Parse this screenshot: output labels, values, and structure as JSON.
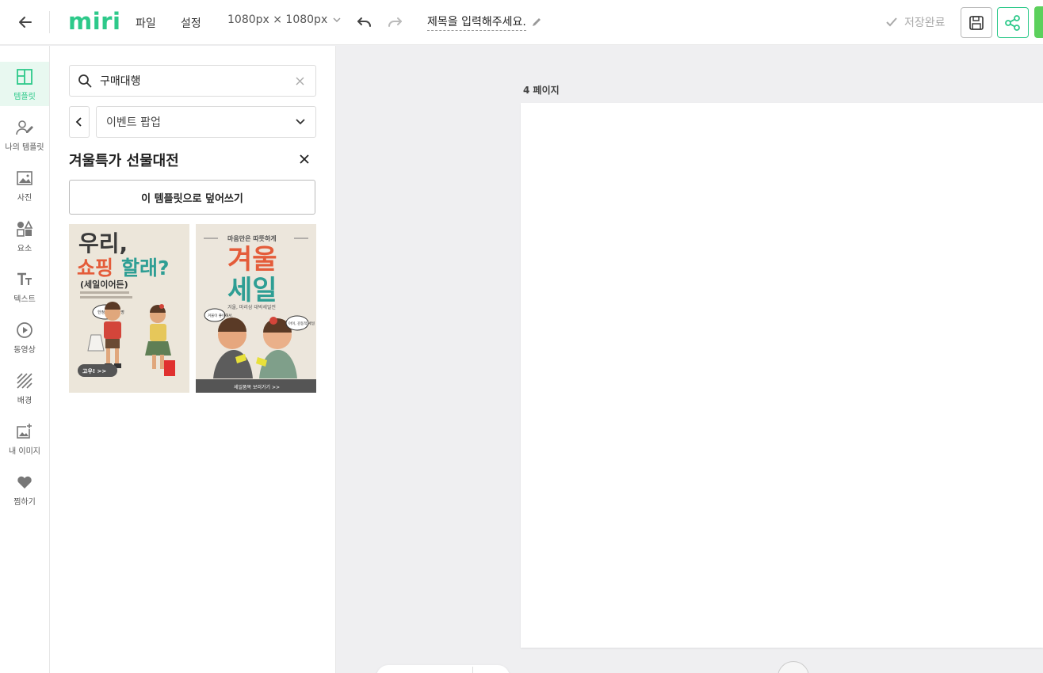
{
  "topbar": {
    "logo": "miri",
    "menu_file": "파일",
    "menu_settings": "설정",
    "size": "1080px × 1080px",
    "doc_title": "제목을 입력해주세요.",
    "save_status": "저장완료"
  },
  "rail": {
    "items": [
      {
        "label": "템플릿",
        "icon": "template-icon"
      },
      {
        "label": "나의 템플릿",
        "icon": "my-template-icon"
      },
      {
        "label": "사진",
        "icon": "photo-icon"
      },
      {
        "label": "요소",
        "icon": "elements-icon"
      },
      {
        "label": "텍스트",
        "icon": "text-icon"
      },
      {
        "label": "동영상",
        "icon": "video-icon"
      },
      {
        "label": "배경",
        "icon": "background-icon"
      },
      {
        "label": "내 이미지",
        "icon": "my-image-icon"
      },
      {
        "label": "찜하기",
        "icon": "heart-icon"
      }
    ]
  },
  "panel": {
    "search_value": "구매대행",
    "category": "이벤트 팝업",
    "set_title": "겨울특가 선물대전",
    "apply_label": "이 템플릿으로 덮어쓰기",
    "thumbnails": [
      {
        "line1": "우리,",
        "line2a": "쇼핑",
        "line2b": "할래?",
        "line3": "(세일이어든)",
        "bubble": "한정판 출간보명",
        "cta": "고우! >>"
      },
      {
        "top": "마음만은 따뜻하게",
        "line1": "겨울",
        "line2": "세일",
        "sub": "겨울, 마리삼 대박세일전",
        "bubble_left": "겨울이 좋아해서.",
        "bubble_right": "아이, 감동적 세일",
        "cta": "세일품목 보러가기 >>"
      }
    ]
  },
  "workspace": {
    "page_label": "4 페이지"
  },
  "colors": {
    "accent": "#2dc98a",
    "active_bg": "#e8f8f0"
  }
}
